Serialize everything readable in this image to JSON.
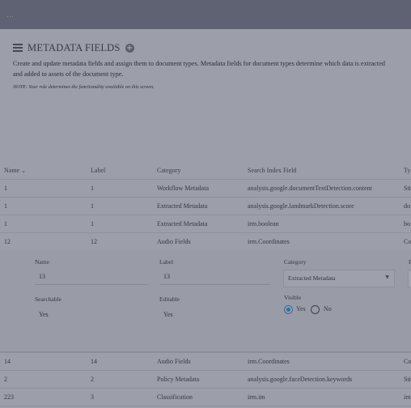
{
  "header": {
    "title": "METADATA FIELDS",
    "description": "Create and update metadata fields and assign them to document types. Metadata fields for document types determine which data is extracted and added to assets of the document type.",
    "note": "NOTE: Your role determines the functionality available on this screen."
  },
  "table": {
    "columns": [
      "Name",
      "Label",
      "Category",
      "Search Index Field",
      "Ty"
    ],
    "sort_indicator": "⌄",
    "rows_top": [
      [
        "1",
        "1",
        "Workflow Metadata",
        "analysis.google.documentTextDetection.content",
        "Sti"
      ],
      [
        "1",
        "1",
        "Extracted Metadata",
        "analysis.google.landmarkDetection.score",
        "do"
      ],
      [
        "1",
        "1",
        "Extracted Metadata",
        "irm.boolean",
        "bo"
      ],
      [
        "12",
        "12",
        "Audio Fields",
        "irm.Coordinates",
        "Co"
      ]
    ],
    "rows_bottom": [
      [
        "14",
        "14",
        "Audio Fields",
        "irm.Coordinates",
        "Co"
      ],
      [
        "2",
        "2",
        "Policy Metadata",
        "analysis.google.faceDetection.keywords",
        "Sti"
      ],
      [
        "223",
        "3",
        "Classification",
        "irm.im",
        "im"
      ]
    ]
  },
  "editor": {
    "name_label": "Name",
    "name_value": "13",
    "label_label": "Label",
    "label_value": "13",
    "category_label": "Category",
    "category_value": "Extracted Metadata",
    "searchable_label": "Searchable",
    "searchable_value": "Yes",
    "editable_label": "Editable",
    "editable_value": "Yes",
    "visible_label": "Visible",
    "visible_yes": "Yes",
    "visible_no": "No",
    "visible_selected": "Yes",
    "extra_column_label": "F"
  }
}
